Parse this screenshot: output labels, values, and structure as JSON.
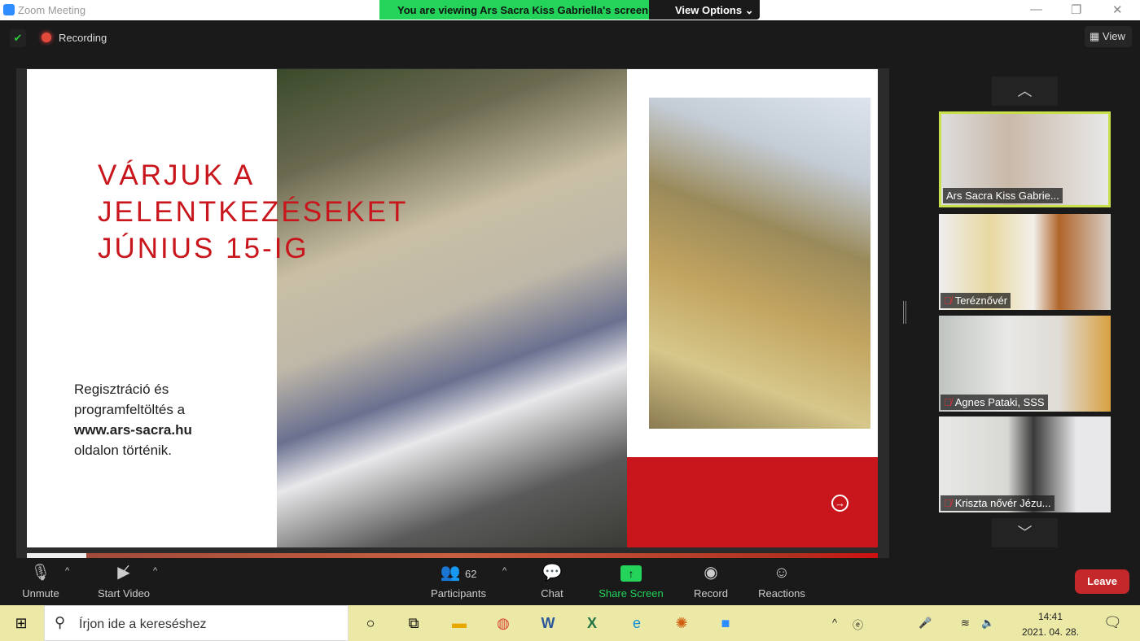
{
  "window": {
    "title": "Zoom Meeting"
  },
  "banner": {
    "viewing": "You are viewing Ars Sacra Kiss Gabriella's screen",
    "view_options": "View Options ⌄"
  },
  "header": {
    "recording": "Recording",
    "view": "View"
  },
  "slide": {
    "headline": [
      "VÁRJUK A",
      "JELENTKEZÉSEKET",
      "JÚNIUS 15-IG"
    ],
    "reg_line1": "Regisztráció és",
    "reg_line2": "programfeltöltés a",
    "reg_url": "www.ars-sacra.hu",
    "reg_line4": "oldalon történik.",
    "accent": "#c8161c"
  },
  "participants": [
    {
      "name": "Ars Sacra Kiss Gabrie...",
      "muted": false,
      "active": true
    },
    {
      "name": "Teréznővér",
      "muted": true
    },
    {
      "name": "Agnes Pataki, SSS",
      "muted": true
    },
    {
      "name": "Kriszta nővér Jézu...",
      "muted": true
    }
  ],
  "toolbar": {
    "unmute": "Unmute",
    "start_video": "Start Video",
    "participants": "Participants",
    "participant_count": "62",
    "chat": "Chat",
    "share_screen": "Share Screen",
    "record": "Record",
    "reactions": "Reactions",
    "leave": "Leave"
  },
  "taskbar": {
    "search_placeholder": "Írjon ide a kereséshez",
    "time": "14:41",
    "date": "2021. 04. 28."
  }
}
